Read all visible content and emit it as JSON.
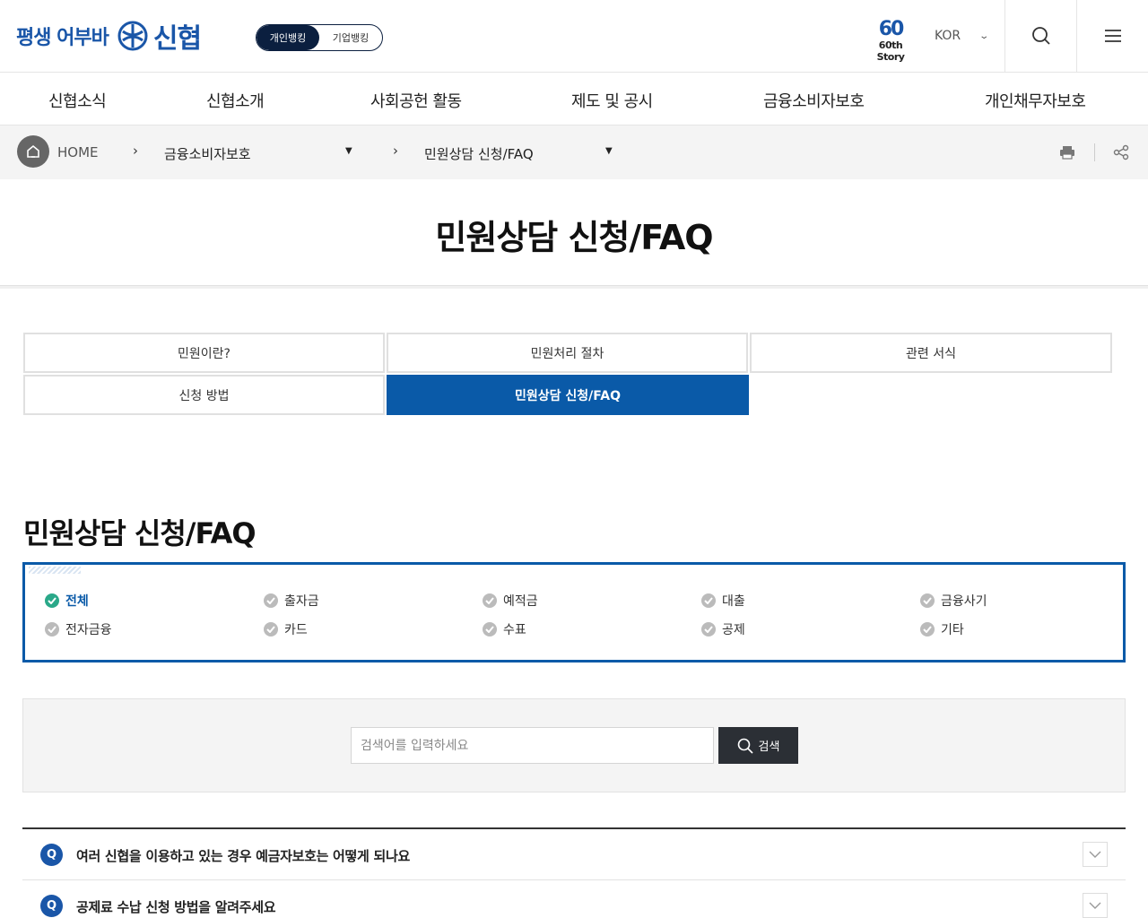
{
  "header": {
    "slogan": "평생 어부바",
    "brand": "신협",
    "bank_toggle": {
      "personal": "개인뱅킹",
      "business": "기업뱅킹"
    },
    "story": {
      "number": "60",
      "text": "60th Story"
    },
    "lang": "KOR"
  },
  "gnb": [
    "신협소식",
    "신협소개",
    "사회공헌 활동",
    "제도 및 공시",
    "금융소비자보호",
    "개인채무자보호"
  ],
  "breadcrumb": {
    "home": "HOME",
    "level1": "금융소비자보호",
    "level2": "민원상담 신청/FAQ"
  },
  "page_title": "민원상담 신청/FAQ",
  "tabs": [
    "민원이란?",
    "민원처리 절차",
    "관련 서식",
    "신청 방법",
    "민원상담 신청/FAQ"
  ],
  "active_tab": "민원상담 신청/FAQ",
  "section_title": "민원상담 신청/FAQ",
  "categories": [
    "전체",
    "출자금",
    "예적금",
    "대출",
    "금융사기",
    "전자금융",
    "카드",
    "수표",
    "공제",
    "기타"
  ],
  "active_category": "전체",
  "search": {
    "placeholder": "검색어를 입력하세요",
    "button": "검색"
  },
  "faq": [
    {
      "q": "Q",
      "text": "여러 신협을 이용하고 있는 경우 예금자보호는 어떻게 되나요"
    },
    {
      "q": "Q",
      "text": "공제료 수납 신청 방법을 알려주세요"
    }
  ],
  "colors": {
    "brand_blue": "#1a56a8",
    "active_tab": "#0a5aa8",
    "check_active": "#2aa889"
  }
}
